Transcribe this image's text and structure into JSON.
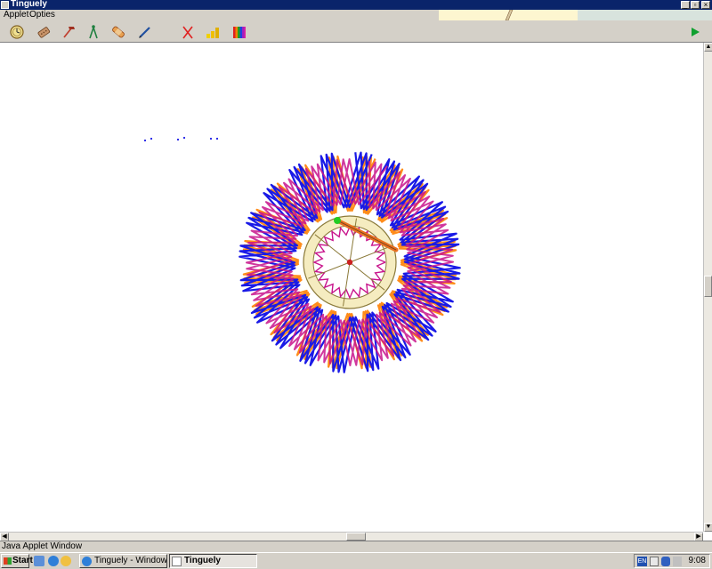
{
  "window": {
    "title": "Tinguely"
  },
  "menu": {
    "items": [
      "Applet",
      "Opties"
    ]
  },
  "toolbar": {
    "tools": [
      {
        "icon": "clock-icon"
      },
      {
        "icon": "eraser-icon"
      },
      {
        "icon": "hammer-icon"
      },
      {
        "icon": "compass-icon"
      },
      {
        "icon": "sticker-icon"
      },
      {
        "icon": "pencil-icon"
      },
      {
        "icon": "delete-icon"
      },
      {
        "icon": "bar-chart-icon"
      },
      {
        "icon": "color-palette-icon"
      }
    ],
    "play_icon": "play-icon"
  },
  "drawing": {
    "colors": {
      "blue": "#1a1ae6",
      "orange": "#ff8c1a",
      "magenta": "#c8148c",
      "gear_fill": "#f5ecc0",
      "gear_stroke": "#8b7a3a",
      "pen": "#e87020",
      "pivot_green": "#22cc22",
      "hub_red": "#cc2020"
    }
  },
  "statusbar": {
    "text": "Java Applet Window"
  },
  "taskbar": {
    "start_label": "Start",
    "buttons": [
      {
        "label": "Tinguely - Windows Inter...",
        "active": false
      },
      {
        "label": "Tinguely",
        "active": true
      }
    ],
    "tray_lang": "EN",
    "clock": "9:08"
  }
}
